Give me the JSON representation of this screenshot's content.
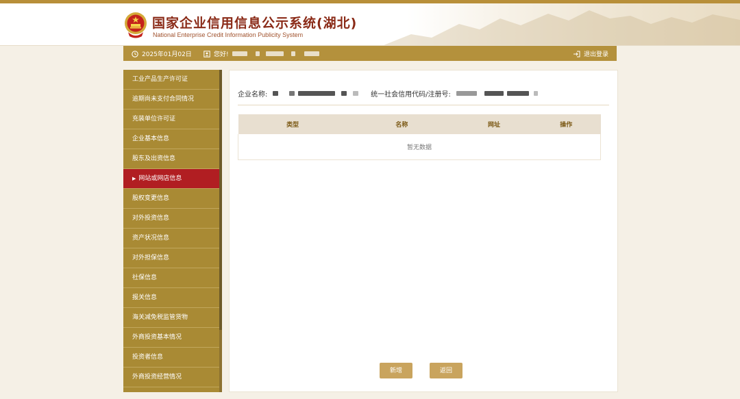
{
  "header": {
    "title": "国家企业信用信息公示系统(湖北)",
    "subtitle": "National Enterprise Credit Information Publicity System"
  },
  "infobar": {
    "date": "2025年01月02日",
    "greeting": "您好!",
    "logout": "退出登录"
  },
  "sidebar": {
    "items": [
      {
        "label": "工业产品生产许可证"
      },
      {
        "label": "逾期尚未支付合同情况"
      },
      {
        "label": "充装单位许可证"
      },
      {
        "label": "企业基本信息"
      },
      {
        "label": "股东及出资信息"
      },
      {
        "label": "网站或网店信息",
        "active": true
      },
      {
        "label": "股权变更信息"
      },
      {
        "label": "对外投资信息"
      },
      {
        "label": "资产状况信息"
      },
      {
        "label": "对外担保信息"
      },
      {
        "label": "社保信息"
      },
      {
        "label": "报关信息"
      },
      {
        "label": "海关减免税监管货物"
      },
      {
        "label": "外商投资基本情况"
      },
      {
        "label": "投资者信息"
      },
      {
        "label": "外商投资经营情况"
      }
    ]
  },
  "main": {
    "company_name_label": "企业名称:",
    "credit_code_label": "统一社会信用代码/注册号:",
    "table": {
      "headers": [
        "类型",
        "名称",
        "网址",
        "操作"
      ],
      "empty_text": "暂无数据"
    },
    "add_button": "新增",
    "back_button": "返回"
  },
  "colors": {
    "brand_gold": "#b4913c",
    "sidebar_bg": "#a98a34",
    "active_red": "#b11e22",
    "button": "#c9a45e"
  }
}
